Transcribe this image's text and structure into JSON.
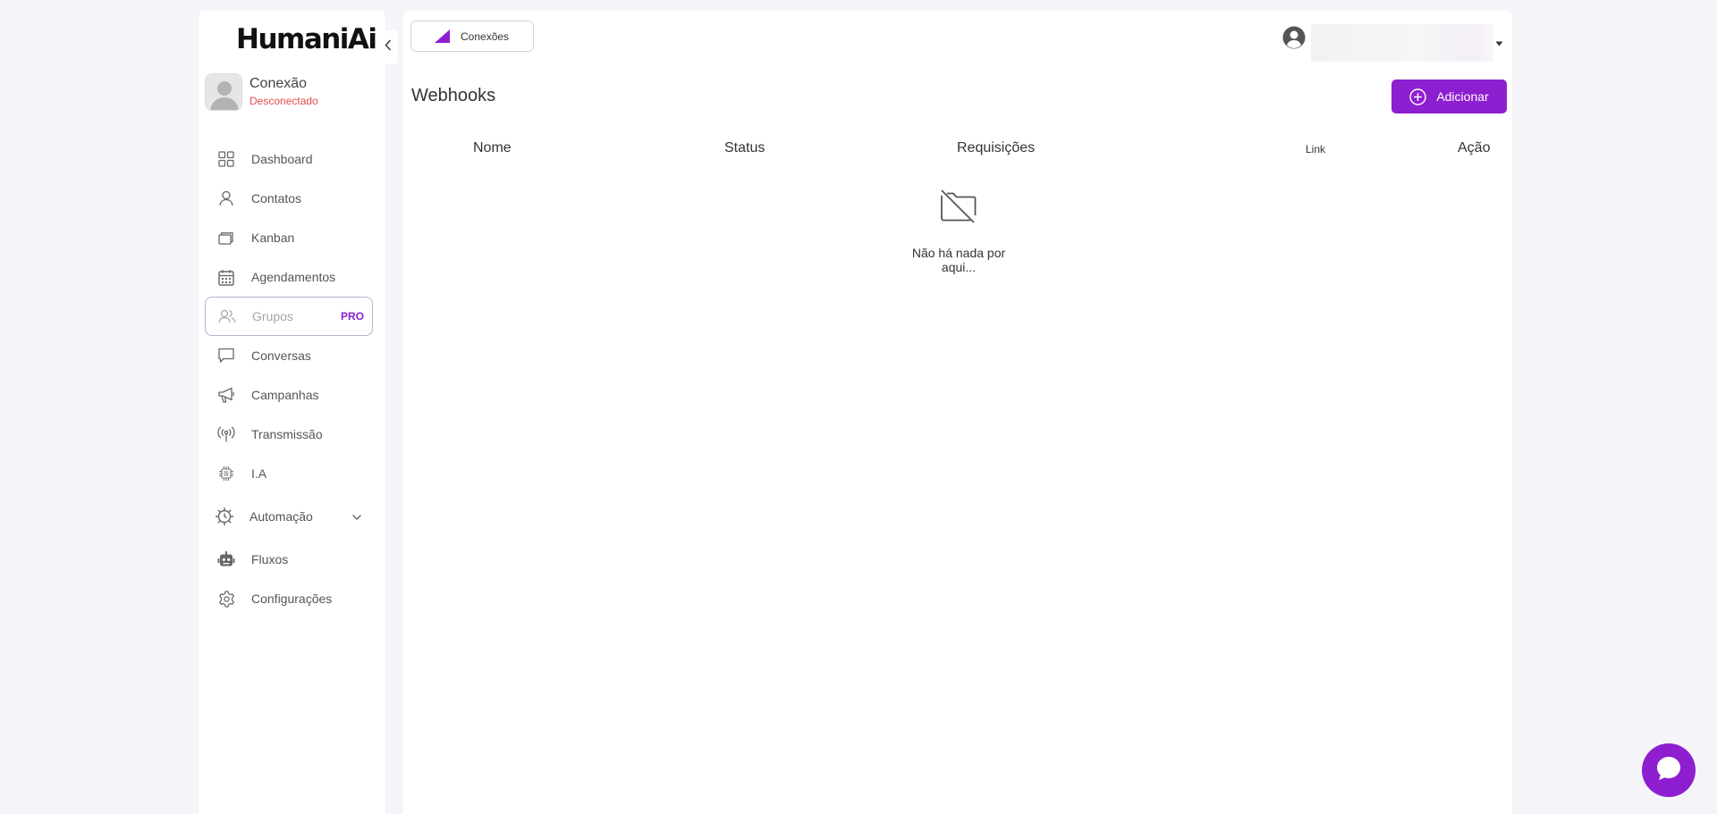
{
  "app": {
    "logo": "HumaniAi"
  },
  "connection": {
    "title": "Conexão",
    "status": "Desconectado",
    "status_color": "#e24b4b"
  },
  "sidebar": {
    "items": [
      {
        "label": "Dashboard",
        "icon": "dashboard-grid-icon"
      },
      {
        "label": "Contatos",
        "icon": "user-icon"
      },
      {
        "label": "Kanban",
        "icon": "kanban-cards-icon"
      },
      {
        "label": "Agendamentos",
        "icon": "calendar-icon"
      },
      {
        "label": "Grupos",
        "icon": "users-icon",
        "badge": "PRO"
      },
      {
        "label": "Conversas",
        "icon": "chat-bubble-icon"
      },
      {
        "label": "Campanhas",
        "icon": "megaphone-icon"
      },
      {
        "label": "Transmissão",
        "icon": "broadcast-icon"
      },
      {
        "label": "I.A",
        "icon": "chip-icon"
      },
      {
        "label": "Automação",
        "icon": "gear-cog-icon"
      },
      {
        "label": "Fluxos",
        "icon": "robot-icon"
      },
      {
        "label": "Configurações",
        "icon": "settings-icon"
      }
    ]
  },
  "header": {
    "tab_label": "Conexões"
  },
  "page": {
    "title": "Webhooks",
    "add_button": "Adicionar",
    "columns": [
      "Nome",
      "Status",
      "Requisições",
      "Link",
      "Ação"
    ],
    "empty_message": "Não há nada por aqui..."
  },
  "colors": {
    "accent": "#8e1fd0",
    "background": "#f4f4f9",
    "error": "#e24b4b"
  }
}
